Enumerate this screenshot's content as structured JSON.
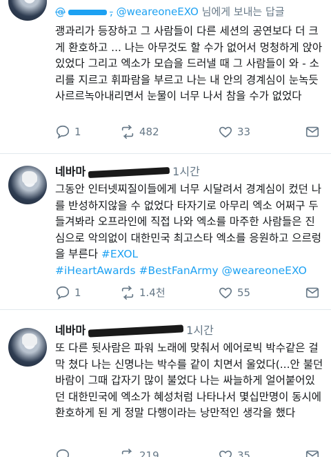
{
  "tweet1": {
    "reply_prefix": "@",
    "reply_handle": "@weareoneEXO",
    "reply_suffix": " 님에게 보내는 답글",
    "text": "괭과리가 등장하고 그 사람들이 다른 세션의 공연보다 더 크게 환호하고 ... 나는 아무것도 할 수가 없어서 멍청하게 앉아있었다 그리고 엑소가 모습을 드러낼 때 그 사람들이 와 - 소리를 지르고 휘파람을 부르고 나는 내 안의 경계심이 눈녹듯 사르르녹아내리면서 눈물이 너무 나서 참을 수가 없었다",
    "replies": "1",
    "retweets": "482",
    "likes": "33"
  },
  "tweet2": {
    "name": "네바마",
    "time": "1시간",
    "text": "그동안 인터넷찌질이들에게 너무 시달려서 경계심이 컸던 나를 반성하지않을 수 없었다 타자기로 아무리 엑소 어쩌구 두들겨봐라 오프라인에 직접 나와 엑소를 마주한 사람들은 진심으로 악의없이 대한민국 최고스타 엑소를 응원하고 으르렁을 부른다",
    "hashtags": "#EXOL #iHeartAwards #BestFanArmy @weareoneEXO",
    "hashtag_line1": "#EXOL",
    "hashtag_line2": "#iHeartAwards #BestFanArmy @weareoneEXO",
    "replies": "1",
    "retweets": "1.4천",
    "likes": "55"
  },
  "tweet3": {
    "name": "네바마",
    "time": "1시간",
    "text": "또 다른 뒷사람은 파워 노래에 맞춰서 에어로빅 박수같은 걸 막 쳤다 나는 신명나는 박수를 같이 치면서 울었다(...안 불던 바람이 그때 갑자기 많이 불었다 나는 싸늘하게 얼어붙어있던 대한민국에 엑소가 혜성처럼 나타나서 몇십만명이 동시에 환호하게 된 게 정말 다행이라는 낭만적인 생각을 했다",
    "retweets": "219",
    "likes": "35"
  },
  "colors": {
    "link": "#1da1f2",
    "muted": "#657786",
    "divider": "#e1e8ed"
  }
}
